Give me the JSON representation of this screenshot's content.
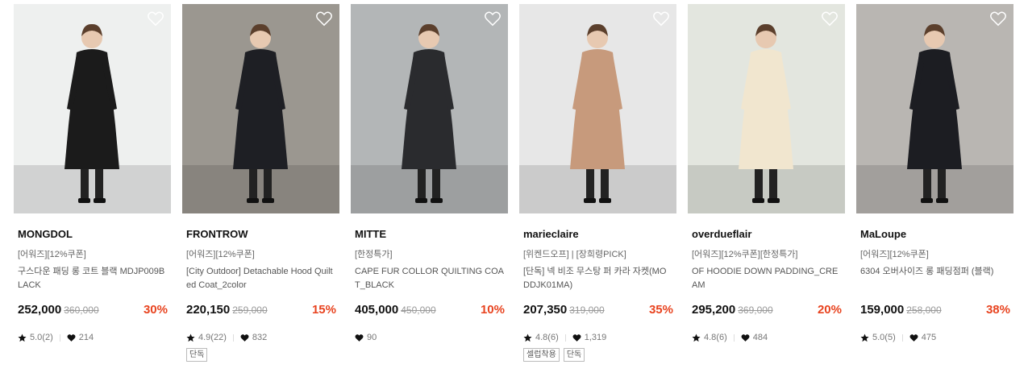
{
  "products": [
    {
      "brand": "MONGDOL",
      "tags": "[어워즈][12%쿠폰]",
      "name": "구스다운 패딩 롱 코트 블랙 MDJP009BLACK",
      "price": "252,000",
      "original_price": "360,000",
      "discount": "30%",
      "rating": "5.0(2)",
      "likes": "214",
      "badges": [],
      "image_bg": "#eef0ef",
      "coat_color": "#1b1b1b"
    },
    {
      "brand": "FRONTROW",
      "tags": "[어워즈][12%쿠폰]",
      "name": "[City Outdoor] Detachable Hood Quilted Coat_2color",
      "price": "220,150",
      "original_price": "259,000",
      "discount": "15%",
      "rating": "4.9(22)",
      "likes": "832",
      "badges": [
        "단독"
      ],
      "image_bg": "#9b9790",
      "coat_color": "#1e1f24"
    },
    {
      "brand": "MITTE",
      "tags": "[한정특가]",
      "name": "CAPE FUR COLLOR QUILTING COAT_BLACK",
      "price": "405,000",
      "original_price": "450,000",
      "discount": "10%",
      "rating": "",
      "likes": "90",
      "badges": [],
      "image_bg": "#b3b6b7",
      "coat_color": "#2a2b2e"
    },
    {
      "brand": "marieclaire",
      "tags": "[위켄드오프] | [장희령PICK]",
      "name": "[단독] 넥 비조 무스탕 퍼 카라 자켓(MODDJK01MA)",
      "price": "207,350",
      "original_price": "319,000",
      "discount": "35%",
      "rating": "4.8(6)",
      "likes": "1,319",
      "badges": [
        "셀럽착용",
        "단독"
      ],
      "image_bg": "#e7e7e7",
      "coat_color": "#c79a7c"
    },
    {
      "brand": "overdueflair",
      "tags": "[어워즈][12%쿠폰][한정특가]",
      "name": "OF HOODIE DOWN PADDING_CREAM",
      "price": "295,200",
      "original_price": "369,000",
      "discount": "20%",
      "rating": "4.8(6)",
      "likes": "484",
      "badges": [],
      "image_bg": "#e3e6df",
      "coat_color": "#f1e6cf"
    },
    {
      "brand": "MaLoupe",
      "tags": "[어워즈][12%쿠폰]",
      "name": "6304 오버사이즈 롱 패딩점퍼 (블랙)",
      "price": "159,000",
      "original_price": "258,000",
      "discount": "38%",
      "rating": "5.0(5)",
      "likes": "475",
      "badges": [],
      "image_bg": "#b9b6b2",
      "coat_color": "#1c1d22"
    }
  ],
  "icons": {
    "wishlist": "heart-outline-icon",
    "rating": "star-icon",
    "likes": "heart-icon"
  },
  "colors": {
    "discount": "#e8431f",
    "brand_text": "#111111",
    "muted_text": "#999999"
  }
}
